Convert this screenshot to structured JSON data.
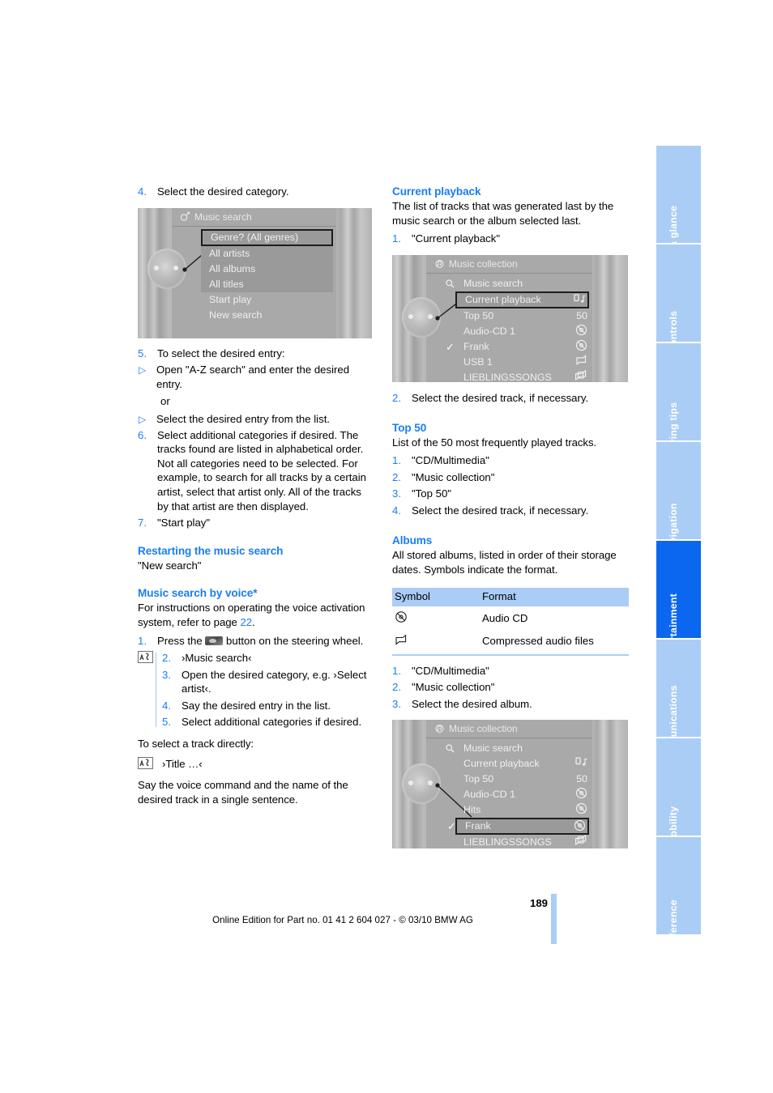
{
  "page": {
    "number": "189",
    "footer": "Online Edition for Part no. 01 41 2 604 027 - © 03/10 BMW AG"
  },
  "colors": {
    "accent_blue": "#1a7ef4",
    "tab_blue": "#aacdf5",
    "tab_active_blue": "#0b67f0",
    "table_header": "#aacdf5",
    "screen_gray": "#a9a9a9"
  },
  "rail": {
    "tabs": [
      {
        "label": "At a glance",
        "active": false
      },
      {
        "label": "Controls",
        "active": false
      },
      {
        "label": "Driving tips",
        "active": false
      },
      {
        "label": "Navigation",
        "active": false
      },
      {
        "label": "Entertainment",
        "active": true
      },
      {
        "label": "Communications",
        "active": false
      },
      {
        "label": "Mobility",
        "active": false
      },
      {
        "label": "Reference",
        "active": false
      }
    ]
  },
  "left_column": {
    "step4": {
      "num": "4.",
      "text": "Select the desired category."
    },
    "screenshot1": {
      "title": "Music search",
      "title_icon": "music-search-icon",
      "rows": [
        {
          "label": "Genre? (All genres)",
          "selected": true,
          "shade": true
        },
        {
          "label": "All artists",
          "selected": false,
          "shade": true
        },
        {
          "label": "All albums",
          "selected": false,
          "shade": true
        },
        {
          "label": "All titles",
          "selected": false,
          "shade": true
        },
        {
          "label": "Start play",
          "selected": false,
          "shade": false
        },
        {
          "label": "New search",
          "selected": false,
          "shade": false
        }
      ]
    },
    "step5": {
      "num": "5.",
      "text": "To select the desired entry:",
      "bullets": [
        "Open \"A-Z search\" and enter the desired entry.",
        "Select the desired entry from the list."
      ],
      "or": "or"
    },
    "step6": {
      "num": "6.",
      "para1": "Select additional categories if desired. The tracks found are listed in alphabetical order.",
      "para2": "Not all categories need to be selected. For example, to search for all tracks by a certain artist, select that artist only. All of the tracks by that artist are then displayed."
    },
    "step7": {
      "num": "7.",
      "text": "\"Start play\""
    },
    "restart": {
      "heading": "Restarting the music search",
      "text": "\"New search\""
    },
    "voice_search": {
      "heading": "Music search by voice*",
      "intro_before": "For instructions on operating the voice activation system, refer to page ",
      "intro_link": "22",
      "intro_after": ".",
      "step1_num": "1.",
      "step1_before": "Press the ",
      "step1_icon": "steering-wheel-voice-button-icon",
      "step1_after": " button on the steering wheel.",
      "voice_icon": "voice-command-icon",
      "steps": [
        {
          "num": "2.",
          "text": "›Music search‹"
        },
        {
          "num": "3.",
          "text": "Open the desired category, e.g. ›Select artist‹."
        },
        {
          "num": "4.",
          "text": "Say the desired entry in the list."
        },
        {
          "num": "5.",
          "text": "Select additional categories if desired."
        }
      ],
      "direct_intro": "To select a track directly:",
      "direct_command": "›Title …‹",
      "direct_icon": "voice-command-icon",
      "direct_note": "Say the voice command and the name of the desired track in a single sentence."
    }
  },
  "right_column": {
    "current_playback": {
      "heading": "Current playback",
      "text": "The list of tracks that was generated last by the music search or the album selected last.",
      "step1": {
        "num": "1.",
        "text": "\"Current playback\""
      },
      "step2": {
        "num": "2.",
        "text": "Select the desired track, if necessary."
      }
    },
    "screenshot2": {
      "title": "Music collection",
      "title_icon": "music-collection-icon",
      "rows": [
        {
          "label": "Music search",
          "icon": "search-icon",
          "right": "",
          "selected": false,
          "check": false
        },
        {
          "label": "Current playback",
          "icon": "",
          "right": "usb-note-icon",
          "selected": true,
          "check": false
        },
        {
          "label": "Top 50",
          "icon": "",
          "right": "50",
          "selected": false,
          "check": false
        },
        {
          "label": "Audio-CD 1",
          "icon": "",
          "right": "cd-icon",
          "selected": false,
          "check": false
        },
        {
          "label": "Frank",
          "icon": "",
          "right": "cd-icon",
          "selected": false,
          "check": true
        },
        {
          "label": "USB 1",
          "icon": "",
          "right": "folder-icon",
          "selected": false,
          "check": false
        },
        {
          "label": "LIEBLINGSSONGS",
          "icon": "",
          "right": "folders-icon",
          "selected": false,
          "check": false
        }
      ]
    },
    "top50": {
      "heading": "Top 50",
      "text": "List of the 50 most frequently played tracks.",
      "steps": [
        {
          "num": "1.",
          "text": "\"CD/Multimedia\""
        },
        {
          "num": "2.",
          "text": "\"Music collection\""
        },
        {
          "num": "3.",
          "text": "\"Top 50\""
        },
        {
          "num": "4.",
          "text": "Select the desired track, if necessary."
        }
      ]
    },
    "albums": {
      "heading": "Albums",
      "text": "All stored albums, listed in order of their storage dates. Symbols indicate the format.",
      "table": {
        "headers": [
          "Symbol",
          "Format"
        ],
        "rows": [
          {
            "symbol": "cd-icon",
            "format": "Audio CD"
          },
          {
            "symbol": "folder-icon",
            "format": "Compressed audio files"
          }
        ]
      },
      "steps": [
        {
          "num": "1.",
          "text": "\"CD/Multimedia\""
        },
        {
          "num": "2.",
          "text": "\"Music collection\""
        },
        {
          "num": "3.",
          "text": "Select the desired album."
        }
      ]
    },
    "screenshot3": {
      "title": "Music collection",
      "title_icon": "music-collection-icon",
      "rows": [
        {
          "label": "Music search",
          "icon": "search-icon",
          "right": "",
          "selected": false,
          "check": false
        },
        {
          "label": "Current playback",
          "icon": "",
          "right": "usb-note-icon",
          "selected": false,
          "check": false
        },
        {
          "label": "Top 50",
          "icon": "",
          "right": "50",
          "selected": false,
          "check": false
        },
        {
          "label": "Audio-CD 1",
          "icon": "",
          "right": "cd-icon",
          "selected": false,
          "check": false
        },
        {
          "label": "Hits",
          "icon": "",
          "right": "cd-icon",
          "selected": false,
          "check": false
        },
        {
          "label": "Frank",
          "icon": "",
          "right": "cd-icon",
          "selected": true,
          "check": true
        },
        {
          "label": "LIEBLINGSSONGS",
          "icon": "",
          "right": "folders-icon",
          "selected": false,
          "check": false
        }
      ]
    }
  }
}
